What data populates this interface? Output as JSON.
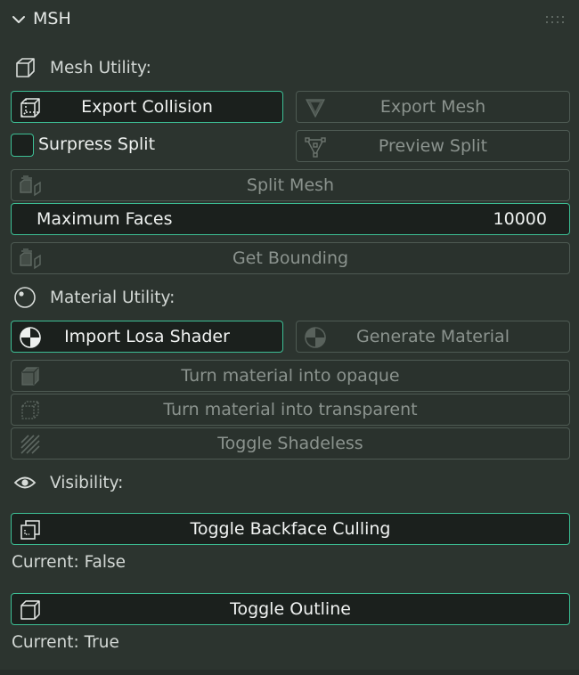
{
  "panel": {
    "title": "MSH"
  },
  "icons": {
    "collapse": "chevron-down-icon",
    "grip": "drag-grip-icon",
    "mesh_section": "cube-icon",
    "material_section": "material-sphere-icon",
    "visibility_section": "eye-icon"
  },
  "colors": {
    "background": "#2c342f",
    "active_border": "#3dbf95",
    "active_fill": "#1b201d",
    "disabled_border": "#4e5a53",
    "disabled_text": "#8b938e"
  },
  "mesh_utility": {
    "label": "Mesh Utility:",
    "export_collision": "Export Collision",
    "export_mesh": "Export Mesh",
    "surpress_split": "Surpress Split",
    "surpress_split_checked": false,
    "preview_split": "Preview Split",
    "split_mesh": "Split Mesh",
    "max_faces_label": "Maximum Faces",
    "max_faces_value": "10000",
    "get_bounding": "Get Bounding"
  },
  "material_utility": {
    "label": "Material Utility:",
    "import_shader": "Import Losa Shader",
    "generate_material": "Generate Material",
    "to_opaque": "Turn material into opaque",
    "to_transparent": "Turn material into transparent",
    "toggle_shadeless": "Toggle Shadeless"
  },
  "visibility": {
    "label": "Visibility:",
    "toggle_backface": "Toggle Backface Culling",
    "backface_status": "Current: False",
    "toggle_outline": "Toggle Outline",
    "outline_status": "Current: True"
  }
}
